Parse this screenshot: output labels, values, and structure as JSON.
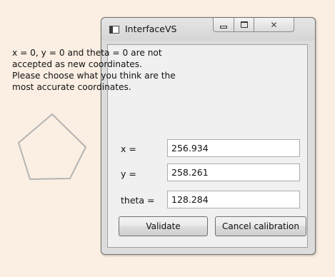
{
  "window": {
    "title": "InterfaceVS"
  },
  "icons": {
    "app": "app-window-icon",
    "minimize": "minimize-icon",
    "maximize": "maximize-icon",
    "close": "close-icon",
    "close_glyph": "✕"
  },
  "message": {
    "lines": [
      "x = 0, y = 0 and theta = 0 are not",
      "accepted as new coordinates.",
      "Please choose what you think are the",
      "most accurate coordinates."
    ]
  },
  "fields": {
    "x": {
      "label": "x =",
      "value": "256.934"
    },
    "y": {
      "label": "y =",
      "value": "258.261"
    },
    "theta": {
      "label": "theta =",
      "value": "128.284"
    }
  },
  "buttons": {
    "validate": "Validate",
    "cancel": "Cancel calibration"
  },
  "colors": {
    "background": "#fbefe3",
    "pentagon_stroke": "#b4b4b4",
    "window_frame": "#dcdcdc",
    "client_area": "#f0f0f0"
  }
}
